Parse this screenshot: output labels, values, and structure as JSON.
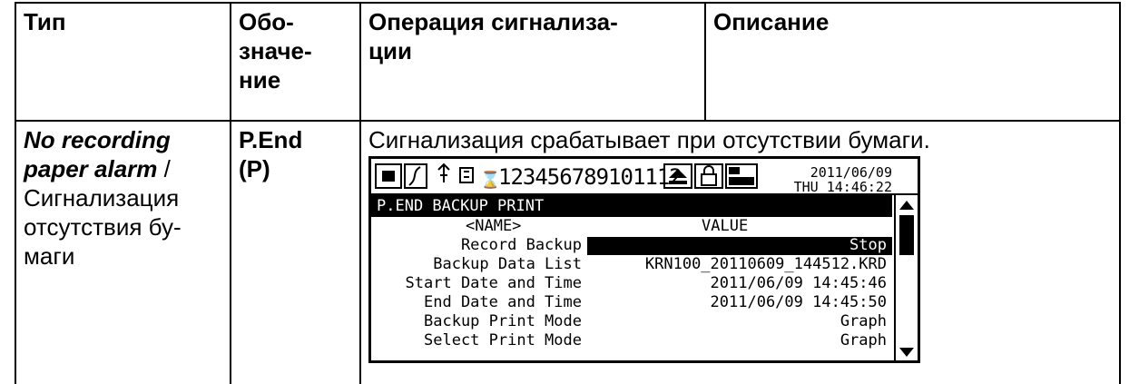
{
  "headers": {
    "type": "Тип",
    "designation_1": "Обо-",
    "designation_2": "значе-",
    "designation_3": "ние",
    "operation_1": "Операция сигнализа-",
    "operation_2": "ции",
    "description": "Описание"
  },
  "row": {
    "type_en_1": "No recording",
    "type_en_2": "paper alarm",
    "type_sep": " /",
    "type_ru_1": "Сигнализация",
    "type_ru_2": "отсутствия бу-",
    "type_ru_3": "маги",
    "designation_1": "P.End",
    "designation_2": "(P)",
    "operation_text": "Сигнализация срабатывает при отсутствии бумаги."
  },
  "screen": {
    "channels": "123456789101112",
    "date": "2011/06/09",
    "time": "THU 14:46:22",
    "menu_title": "P.END BACKUP PRINT",
    "col_name": "<NAME>",
    "col_value": "VALUE",
    "rows": [
      {
        "name": "Record Backup",
        "value": "Stop"
      },
      {
        "name": "Backup Data List",
        "value": "KRN100_20110609_144512.KRD"
      },
      {
        "name": "Start Date and Time",
        "value": "2011/06/09 14:45:46"
      },
      {
        "name": "End Date and Time",
        "value": "2011/06/09 14:45:50"
      },
      {
        "name": "Backup Print Mode",
        "value": "Graph"
      },
      {
        "name": "Select Print Mode",
        "value": "Graph"
      }
    ]
  }
}
